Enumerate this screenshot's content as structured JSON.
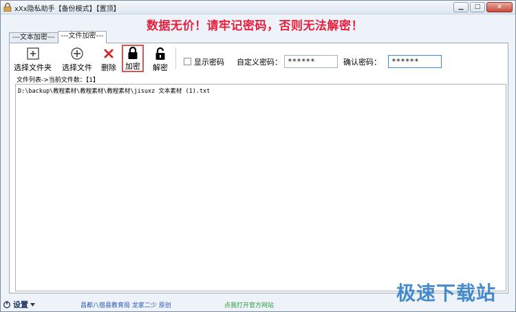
{
  "window": {
    "title": "xXx隐私助手【备份模式】【置顶】",
    "controls": {
      "minimize_icon": "minimize-icon",
      "maximize_icon": "maximize-icon",
      "close_icon": "close-icon"
    }
  },
  "warning": "数据无价！请牢记密码，否则无法解密！",
  "tabs": [
    {
      "label": "---文本加密---",
      "active": false
    },
    {
      "label": "---文件加密---",
      "active": true
    }
  ],
  "toolbar": {
    "select_folder": "选择文件夹",
    "select_file": "选择文件",
    "delete": "删除",
    "encrypt": "加密",
    "decrypt": "解密"
  },
  "options": {
    "show_password": "显示密码",
    "custom_password_label": "自定义密码：",
    "custom_password_value": "******",
    "confirm_password_label": "确认密码：",
    "confirm_password_value": "******"
  },
  "file_list": {
    "header": "文件列表->当前文件数：【1】",
    "items": [
      "D:\\backup\\教程素材\\教程素材\\教程素材\\jisuxz 文本素材 (1).txt"
    ]
  },
  "statusbar": {
    "settings": "设置",
    "credit": "昌都八宿县教育局 龙家二少 原创",
    "site_link": "点我打开官方网站"
  },
  "watermark": "极速下载站",
  "colors": {
    "warning": "#e81e3a",
    "highlight_border": "#d9534f",
    "credit": "#2a56b6",
    "site_link": "#2a9a3a"
  }
}
